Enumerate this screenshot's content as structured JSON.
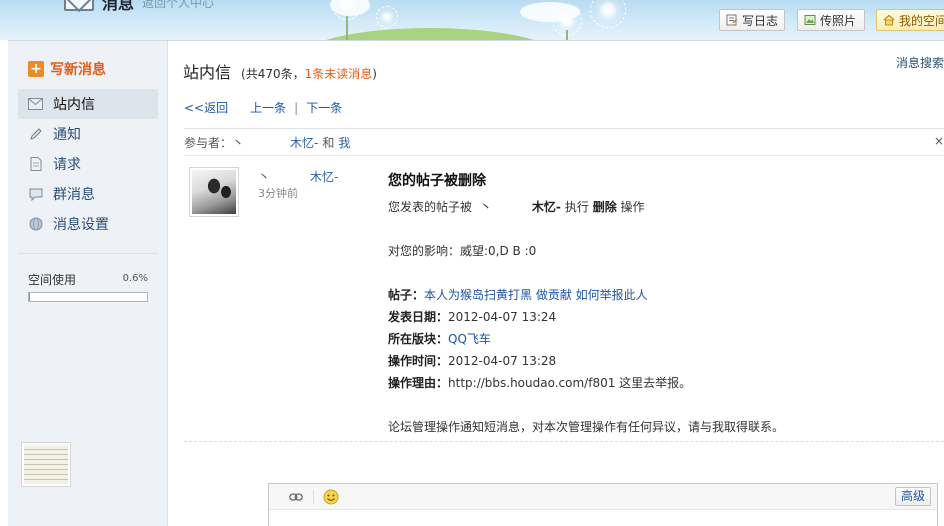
{
  "banner": {
    "title": "消息",
    "subtitle": "返回个人中心",
    "buttons": {
      "write_blog": "写日志",
      "upload_photo": "传照片",
      "my_space": "我的空间"
    }
  },
  "sidebar": {
    "compose_label": "写新消息",
    "items": [
      {
        "label": "站内信",
        "icon": "envelope-icon",
        "active": true
      },
      {
        "label": "通知",
        "icon": "pencil-icon",
        "active": false
      },
      {
        "label": "请求",
        "icon": "document-icon",
        "active": false
      },
      {
        "label": "群消息",
        "icon": "chat-bubble-icon",
        "active": false
      },
      {
        "label": "消息设置",
        "icon": "globe-icon",
        "active": false
      }
    ],
    "usage": {
      "label": "空间使用",
      "percent_text": "0.6%",
      "fraction": 0.006
    }
  },
  "main": {
    "title": "站内信",
    "count_prefix": "(共470条，",
    "unread": "1条未读消息",
    "count_suffix": ")",
    "search_link": "消息搜索",
    "subnav": {
      "back": "<<返回",
      "prev": "上一条",
      "sep": "|",
      "next": "下一条"
    },
    "participants": {
      "label": "参与者：丶",
      "name": "木忆-",
      "and": "和",
      "me": "我",
      "close": "×"
    },
    "message": {
      "sender_prefix": "丶",
      "sender_name": "木忆-",
      "time_ago": "3分钟前",
      "subject": "您的帖子被删除",
      "line1_prefix": "您发表的帖子被",
      "line1_prefix2": "丶",
      "line1_name": "木忆-",
      "line1_action": "执行",
      "line1_action_bold": "删除",
      "line1_suffix": "操作",
      "impact": "对您的影响：威望:0,D B :0",
      "post_label": "帖子：",
      "post_link": "本人为猴岛扫黄打黑 做贡献  如何举报此人",
      "date_label": "发表日期：",
      "date_value": "2012-04-07 13:24",
      "forum_label": "所在版块：",
      "forum_value": "QQ飞车",
      "op_time_label": "操作时间：",
      "op_time_value": "2012-04-07 13:28",
      "reason_label": "操作理由：",
      "reason_value": "http://bbs.houdao.com/f801 这里去举报。",
      "footer": "论坛管理操作通知短消息，对本次管理操作有任何异议，请与我取得联系。"
    },
    "editor": {
      "advanced_label": "高级"
    }
  },
  "colors": {
    "accent_orange": "#e0601a",
    "link_blue": "#1d55a3",
    "sidebar_bg": "#eef2f6"
  }
}
